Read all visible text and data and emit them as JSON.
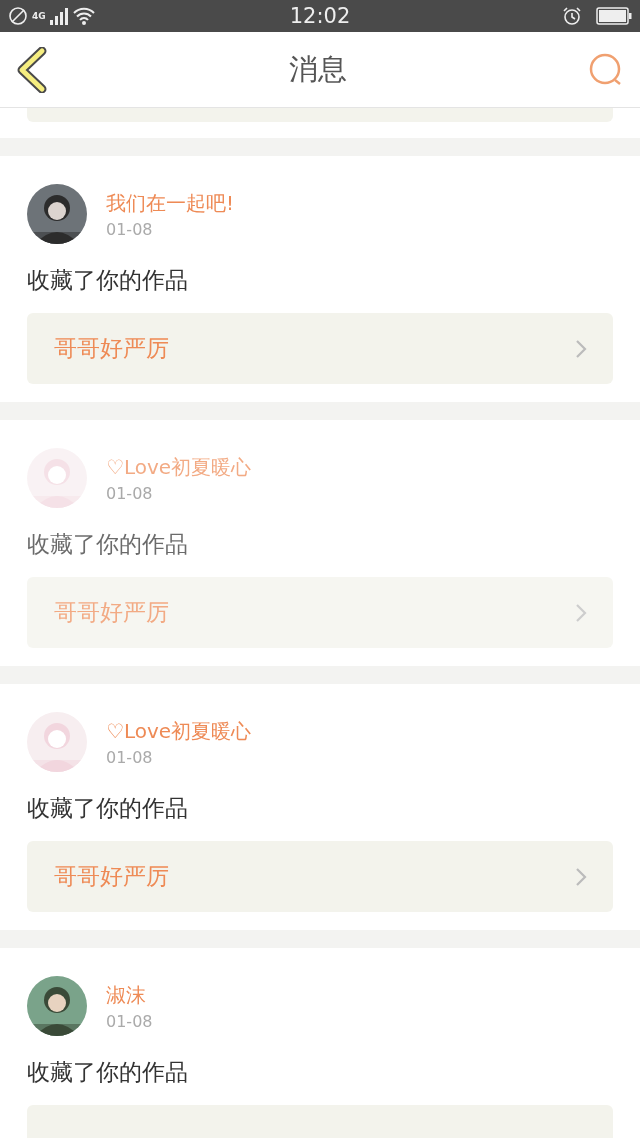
{
  "status_bar": {
    "time": "12:02",
    "network": "4G"
  },
  "header": {
    "title": "消息"
  },
  "messages": [
    {
      "user": "我们在一起吧!",
      "date": "01-08",
      "action": "收藏了你的作品",
      "work": "哥哥好严厉",
      "pressed": false
    },
    {
      "user": "♡Love初夏暖心",
      "date": "01-08",
      "action": "收藏了你的作品",
      "work": "哥哥好严厉",
      "pressed": true
    },
    {
      "user": "♡Love初夏暖心",
      "date": "01-08",
      "action": "收藏了你的作品",
      "work": "哥哥好严厉",
      "pressed": false
    },
    {
      "user": "淑沫",
      "date": "01-08",
      "action": "收藏了你的作品",
      "pressed": false
    }
  ]
}
